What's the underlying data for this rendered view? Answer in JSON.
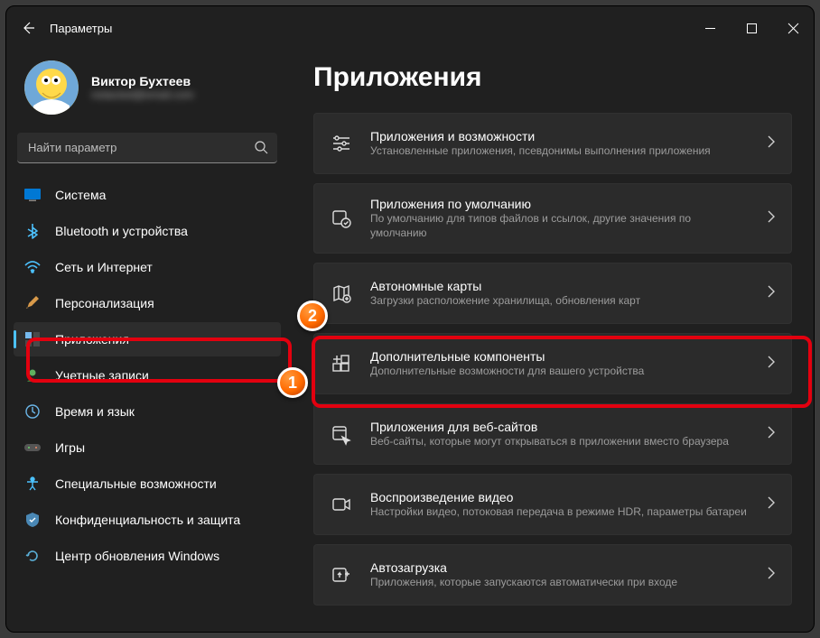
{
  "window": {
    "title": "Параметры"
  },
  "user": {
    "name": "Виктор Бухтеев",
    "email": "redacted@email.com"
  },
  "search": {
    "placeholder": "Найти параметр"
  },
  "sidebar": {
    "items": [
      {
        "label": "Система"
      },
      {
        "label": "Bluetooth и устройства"
      },
      {
        "label": "Сеть и Интернет"
      },
      {
        "label": "Персонализация"
      },
      {
        "label": "Приложения"
      },
      {
        "label": "Учетные записи"
      },
      {
        "label": "Время и язык"
      },
      {
        "label": "Игры"
      },
      {
        "label": "Специальные возможности"
      },
      {
        "label": "Конфиденциальность и защита"
      },
      {
        "label": "Центр обновления Windows"
      }
    ]
  },
  "main": {
    "heading": "Приложения",
    "cards": [
      {
        "title": "Приложения и возможности",
        "sub": "Установленные приложения, псевдонимы выполнения приложения"
      },
      {
        "title": "Приложения по умолчанию",
        "sub": "По умолчанию для типов файлов и ссылок, другие значения по умолчанию"
      },
      {
        "title": "Автономные карты",
        "sub": "Загрузки расположение хранилища, обновления карт"
      },
      {
        "title": "Дополнительные компоненты",
        "sub": "Дополнительные возможности для вашего устройства"
      },
      {
        "title": "Приложения для веб-сайтов",
        "sub": "Веб-сайты, которые могут открываться в приложении вместо браузера"
      },
      {
        "title": "Воспроизведение видео",
        "sub": "Настройки видео, потоковая передача в режиме HDR, параметры батареи"
      },
      {
        "title": "Автозагрузка",
        "sub": "Приложения, которые запускаются автоматически при входе"
      }
    ]
  },
  "annotations": {
    "m1": "1",
    "m2": "2"
  }
}
